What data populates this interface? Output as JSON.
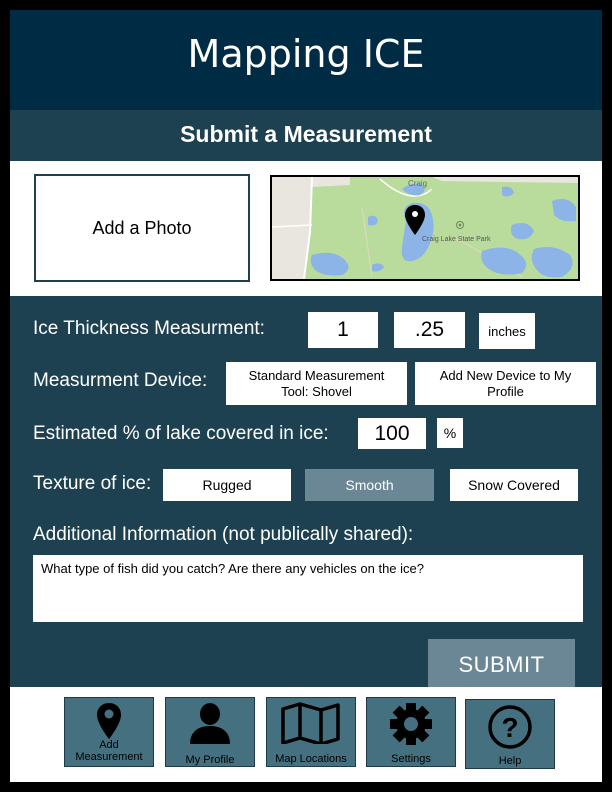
{
  "header": {
    "title": "Mapping ICE"
  },
  "subheader": {
    "title": "Submit a Measurement"
  },
  "media": {
    "photo_label": "Add a Photo",
    "map_labels": {
      "town": "Craig",
      "park": "Craig Lake State Park"
    }
  },
  "form": {
    "thickness": {
      "label": "Ice Thickness Measurment:",
      "whole": "1",
      "fraction": ".25",
      "unit": "inches"
    },
    "device": {
      "label": "Measurment Device:",
      "current": "Standard Measurement Tool: Shovel",
      "add": "Add New Device to My Profile"
    },
    "coverage": {
      "label": "Estimated % of lake covered in ice:",
      "value": "100",
      "unit": "%"
    },
    "texture": {
      "label": "Texture of ice:",
      "options": [
        "Rugged",
        "Smooth",
        "Snow Covered"
      ],
      "selected": "Smooth"
    },
    "additional": {
      "label": "Additional Information (not publically shared):",
      "placeholder": "What type of fish did you catch? Are there any vehicles on the ice?"
    },
    "submit_label": "SUBMIT"
  },
  "nav": {
    "items": [
      {
        "label": "Add Measurement",
        "icon": "map-pin-icon"
      },
      {
        "label": "My Profile",
        "icon": "person-icon"
      },
      {
        "label": "Map Locations",
        "icon": "folded-map-icon"
      },
      {
        "label": "Settings",
        "icon": "gear-icon"
      },
      {
        "label": "Help",
        "icon": "help-icon"
      }
    ]
  },
  "colors": {
    "header_bg": "#002b44",
    "panel_bg": "#1d4150",
    "selected_bg": "#6b8795",
    "nav_bg": "#45707f"
  }
}
